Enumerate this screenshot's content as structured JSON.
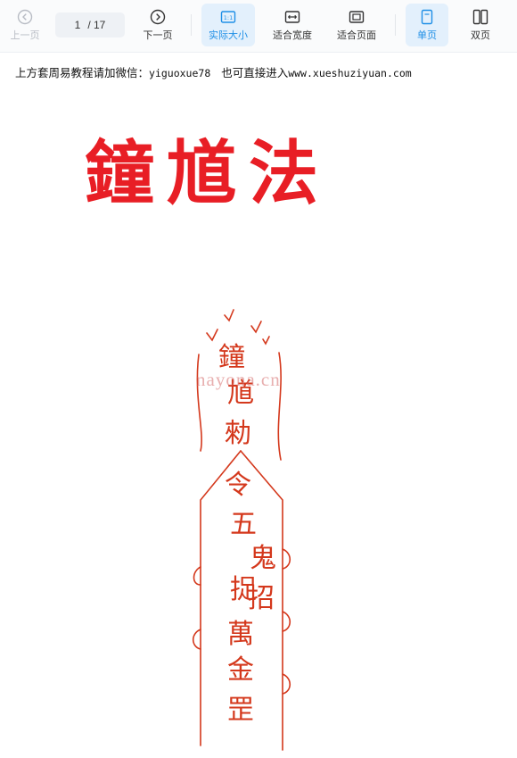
{
  "toolbar": {
    "prev_page": "上一页",
    "current_page": "1",
    "total_pages": "/ 17",
    "next_page": "下一页",
    "actual_size": "实际大小",
    "fit_width": "适合宽度",
    "fit_page": "适合页面",
    "single_page": "单页",
    "double_page": "双页"
  },
  "document": {
    "notice_prefix": "上方套周易教程请加微信：",
    "notice_wechat": "yiguoxue78",
    "notice_middle": "也可直接进入",
    "notice_url": "www.xueshuziyuan.com",
    "title": "鐘馗法",
    "watermark": "nayona.cn",
    "talisman_glyphs": [
      "鐘",
      "馗",
      "勑",
      "令",
      "五",
      "鬼",
      "捉",
      "招",
      "萬",
      "金",
      "罡"
    ]
  },
  "colors": {
    "title_red": "#e81e25",
    "talisman_red": "#d4381c",
    "active_blue": "#1f8fe6"
  }
}
